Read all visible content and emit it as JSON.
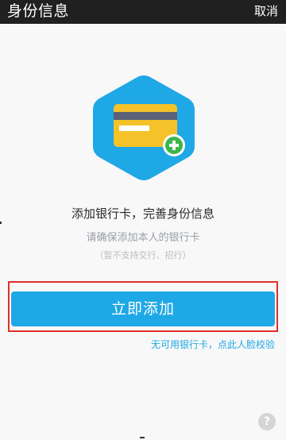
{
  "header": {
    "title": "身份信息",
    "cancel_label": "取消"
  },
  "illustration": {
    "icon": "bank-card-add-icon",
    "hex_color": "#1fa8e6",
    "card_color": "#f5c22a",
    "plus_color": "#3bb54a"
  },
  "main": {
    "headline": "添加银行卡，完善身份信息",
    "subline": "请确保添加本人的银行卡",
    "note": "（暂不支持交行、招行）"
  },
  "actions": {
    "add_button_label": "立即添加",
    "face_verify_link": "无可用银行卡，点此人脸校验",
    "help_label": "?"
  },
  "colors": {
    "accent": "#1fa8e6",
    "highlight_border": "#e0302a"
  }
}
